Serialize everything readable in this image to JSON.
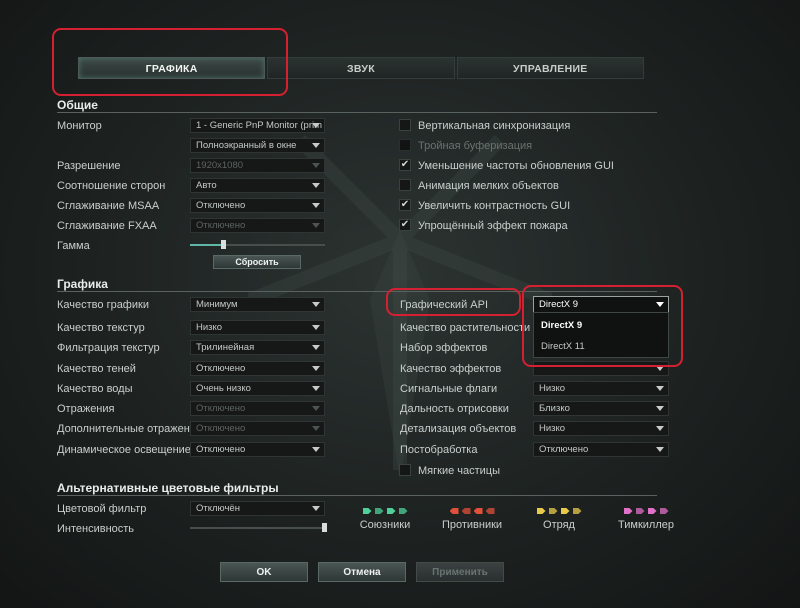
{
  "tabs": [
    {
      "label": "ГРАФИКА",
      "active": true
    },
    {
      "label": "ЗВУК",
      "active": false
    },
    {
      "label": "УПРАВЛЕНИЕ",
      "active": false
    }
  ],
  "general": {
    "title": "Общие",
    "monitor": {
      "label": "Монитор",
      "value": "1 - Generic PnP Monitor (prim"
    },
    "window_mode": {
      "value": "Полноэкранный в окне"
    },
    "resolution": {
      "label": "Разрешение",
      "value": "1920x1080"
    },
    "aspect": {
      "label": "Соотношение сторон",
      "value": "Авто"
    },
    "msaa": {
      "label": "Сглаживание MSAA",
      "value": "Отключено"
    },
    "fxaa": {
      "label": "Сглаживание FXAA",
      "value": "Отключено"
    },
    "gamma": {
      "label": "Гамма",
      "level": 0.25
    },
    "reset_label": "Сбросить",
    "checkboxes": [
      {
        "label": "Вертикальная синхронизация",
        "checked": false,
        "disabled": false
      },
      {
        "label": "Тройная буферизация",
        "checked": false,
        "disabled": true
      },
      {
        "label": "Уменьшение частоты обновления GUI",
        "checked": true,
        "disabled": false
      },
      {
        "label": "Анимация мелких объектов",
        "checked": false,
        "disabled": false
      },
      {
        "label": "Увеличить контрастность GUI",
        "checked": true,
        "disabled": false
      },
      {
        "label": "Упрощённый эффект пожара",
        "checked": true,
        "disabled": false
      }
    ]
  },
  "graphics": {
    "title": "Графика",
    "left": [
      {
        "label": "Качество графики",
        "value": "Минимум",
        "disabled": false
      },
      {
        "label": "Качество текстур",
        "value": "Низко",
        "disabled": false
      },
      {
        "label": "Фильтрация текстур",
        "value": "Трилинейная",
        "disabled": false
      },
      {
        "label": "Качество теней",
        "value": "Отключено",
        "disabled": false
      },
      {
        "label": "Качество воды",
        "value": "Очень низко",
        "disabled": false
      },
      {
        "label": "Отражения",
        "value": "Отключено",
        "disabled": true
      },
      {
        "label": "Дополнительные отражения",
        "value": "Отключено",
        "disabled": true
      },
      {
        "label": "Динамическое освещение",
        "value": "Отключено",
        "disabled": false
      }
    ],
    "api": {
      "label": "Графический API",
      "value": "DirectX 9",
      "options": [
        "DirectX 9",
        "DirectX 11"
      ]
    },
    "right": [
      {
        "label": "Качество растительности",
        "value": ""
      },
      {
        "label": "Набор эффектов",
        "value": ""
      },
      {
        "label": "Качество эффектов",
        "value": ""
      },
      {
        "label": "Сигнальные флаги",
        "value": "Низко"
      },
      {
        "label": "Дальность отрисовки",
        "value": "Близко"
      },
      {
        "label": "Детализация объектов",
        "value": "Низко"
      },
      {
        "label": "Постобработка",
        "value": "Отключено"
      }
    ],
    "soft_particles": {
      "label": "Мягкие частицы",
      "checked": false
    }
  },
  "filters": {
    "title": "Альтернативные цветовые фильтры",
    "filter": {
      "label": "Цветовой фильтр",
      "value": "Отключён"
    },
    "intensity": {
      "label": "Интенсивность",
      "level": 1.0
    },
    "teams": [
      {
        "name": "Союзники",
        "color": "#4fcf9a",
        "dir": "right"
      },
      {
        "name": "Противники",
        "color": "#e0503a",
        "dir": "left"
      },
      {
        "name": "Отряд",
        "color": "#e8c94a",
        "dir": "right"
      },
      {
        "name": "Тимкиллер",
        "color": "#e070c8",
        "dir": "right"
      }
    ]
  },
  "buttons": {
    "ok": "OK",
    "cancel": "Отмена",
    "apply": "Применить"
  },
  "colors": {
    "highlight": "#d42030",
    "accent": "#5fb8a7"
  }
}
